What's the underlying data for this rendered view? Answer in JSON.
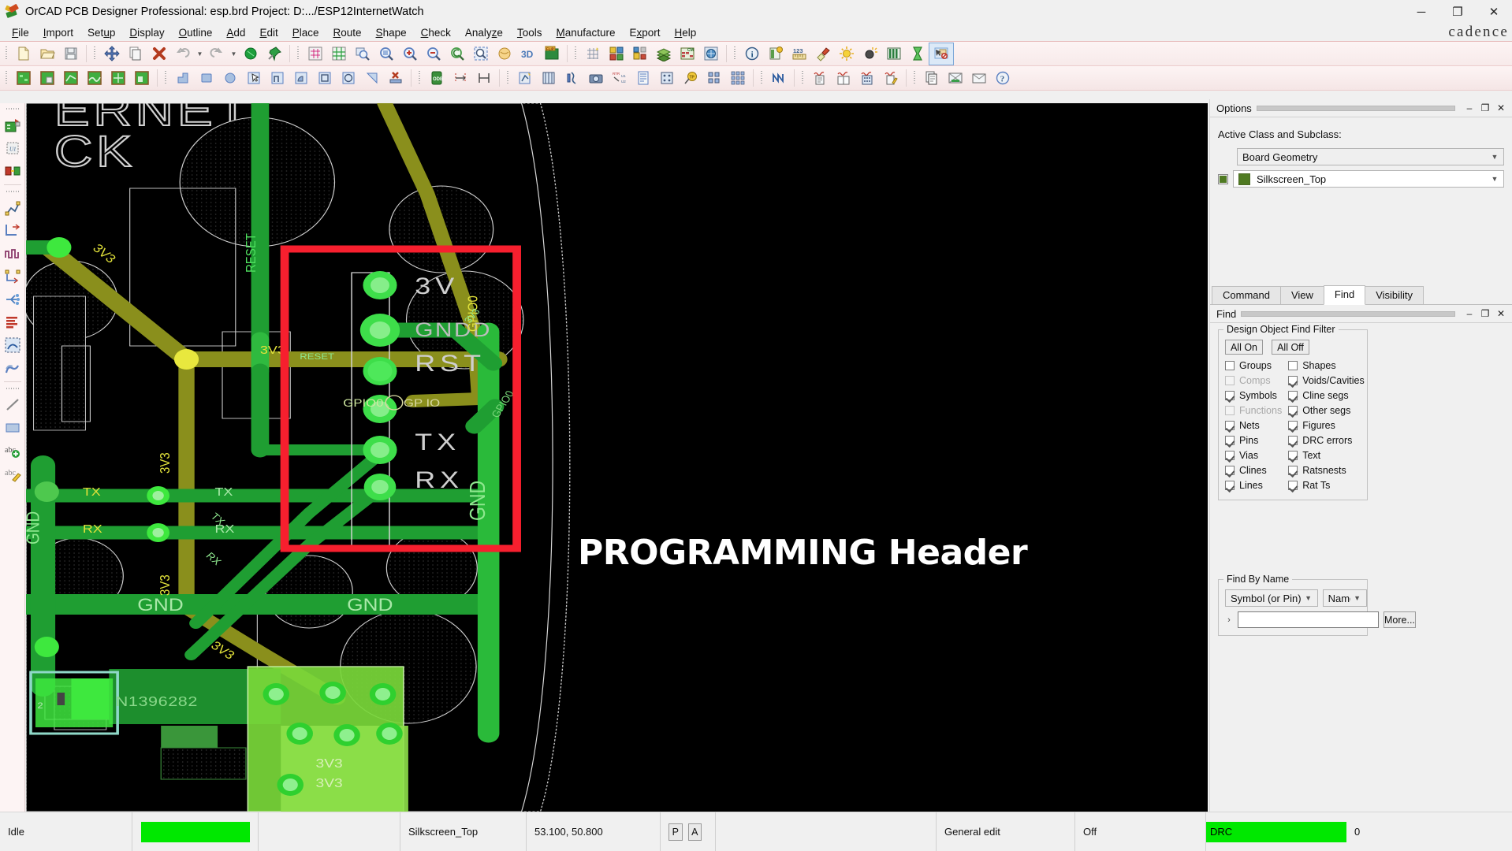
{
  "window": {
    "title": "OrCAD PCB Designer Professional: esp.brd  Project: D:.../ESP12InternetWatch",
    "minimize": "─",
    "maximize": "❐",
    "close": "✕",
    "app_icon": "orcad-logo-icon"
  },
  "menubar": {
    "items": [
      {
        "label": "File",
        "mnemonic": "F"
      },
      {
        "label": "Import",
        "mnemonic": "I"
      },
      {
        "label": "Setup",
        "mnemonic": "u"
      },
      {
        "label": "Display",
        "mnemonic": "D"
      },
      {
        "label": "Outline",
        "mnemonic": "O"
      },
      {
        "label": "Add",
        "mnemonic": "A"
      },
      {
        "label": "Edit",
        "mnemonic": "E"
      },
      {
        "label": "Place",
        "mnemonic": "P"
      },
      {
        "label": "Route",
        "mnemonic": "R"
      },
      {
        "label": "Shape",
        "mnemonic": "S"
      },
      {
        "label": "Check",
        "mnemonic": "C"
      },
      {
        "label": "Analyze",
        "mnemonic": "z"
      },
      {
        "label": "Tools",
        "mnemonic": "T"
      },
      {
        "label": "Manufacture",
        "mnemonic": "M"
      },
      {
        "label": "Export",
        "mnemonic": "x"
      },
      {
        "label": "Help",
        "mnemonic": "H"
      }
    ],
    "brand": "cadence"
  },
  "toolbar_row1": [
    "new-file-icon",
    "open-folder-icon",
    "save-icon",
    "move-icon",
    "copy-icon",
    "delete-icon",
    "undo-icon",
    "undo-dropdown-icon",
    "redo-icon",
    "redo-dropdown-icon",
    "net-highlight-icon",
    "pin-icon",
    "redraw-icon",
    "color-views-icon",
    "zoom-by-points-icon",
    "zoom-fit-icon",
    "zoom-in-icon",
    "zoom-out-icon",
    "zoom-previous-icon",
    "zoom-selection-icon",
    "zoom-world-icon",
    "3d-view-icon",
    "flip-design-icon",
    "grid-toggle-icon",
    "color-visibility-icon",
    "assign-color-icon",
    "layers-icon",
    "constraint-manager-icon",
    "global-visibility-icon",
    "property-info-icon",
    "report-icon",
    "measure-icon",
    "highlight-paint-icon",
    "display-brightness-icon",
    "dimming-icon",
    "layer-bars-icon",
    "hourglass-icon",
    "select-nothing-icon"
  ],
  "toolbar_row2": [
    "shape-add-rect-icon",
    "shape-add-circle-icon",
    "shape-edit-boundary-icon",
    "shape-merge-icon",
    "shape-delete-island-icon",
    "shape-change-icon",
    "place-manual-icon",
    "place-rect-icon",
    "place-circle-icon",
    "select-cursor-icon",
    "place-polygon-icon",
    "place-arc-icon",
    "place-square-icon",
    "place-ellipse-icon",
    "place-line-icon",
    "unplace-icon",
    "odb-export-icon",
    "route-spacing-icon",
    "route-spacing2-icon",
    "drc-check-icon",
    "cross-section-icon",
    "probe-icon",
    "camera-icon",
    "swap-pins-icon",
    "bom-report-icon",
    "padstack-icon",
    "testpoint-icon",
    "array-icon",
    "fanout-icon",
    "net-schedule-icon",
    "waveform-report-icon",
    "library-book-icon",
    "signal-model-icon",
    "signal-edit-icon",
    "docs-icon",
    "cross-probe-icon",
    "letter-icon",
    "help-question-icon"
  ],
  "left_toolbar": [
    "place-component-icon",
    "symbol-u1-icon",
    "swap-component-icon",
    "add-connect-icon",
    "slide-icon",
    "delay-tune-icon",
    "custom-smooth-icon",
    "fanout-by-pin-icon",
    "route-spreadsheet-icon",
    "route-area-icon",
    "gloss-icon",
    "line-icon",
    "rectangle-icon",
    "add-text-icon",
    "edit-text-icon"
  ],
  "canvas": {
    "annotation_title": "PROGRAMMING Header",
    "highlight_rect_color": "#f71f2e",
    "silkscreen_text": [
      "ERNET",
      "CK"
    ],
    "header_pins": [
      {
        "label": "3V",
        "net": "3V3"
      },
      {
        "label": "GND",
        "net": "GND"
      },
      {
        "label": "RST",
        "net": "RESET"
      },
      {
        "label": "GPIO0",
        "net": "GPIO0"
      },
      {
        "label": "TX",
        "net": "TX"
      },
      {
        "label": "RX",
        "net": "RX"
      }
    ],
    "net_labels": [
      "3V3",
      "RESET",
      "GND",
      "TX",
      "RX",
      "GPIO0",
      "GP IO",
      "3V3"
    ],
    "component_ref": "N1396282",
    "secondary_labels": [
      "GNDD",
      "GND",
      "3V3"
    ]
  },
  "options_panel": {
    "dock_title": "Options",
    "active_class_label": "Active Class and Subclass:",
    "class_value": "Board Geometry",
    "subclass_value": "Silkscreen_Top",
    "subclass_color": "#4f7a22",
    "minimize": "–",
    "restore": "❐",
    "close": "✕"
  },
  "panel_tabs": [
    {
      "label": "Command",
      "selected": false
    },
    {
      "label": "View",
      "selected": false
    },
    {
      "label": "Find",
      "selected": true
    },
    {
      "label": "Visibility",
      "selected": false
    }
  ],
  "find_panel": {
    "dock_title": "Find",
    "minimize": "–",
    "restore": "❐",
    "close": "✕",
    "filter_legend": "Design Object Find Filter",
    "all_on": "All On",
    "all_off": "All Off",
    "checkboxes": [
      {
        "label": "Groups",
        "checked": false,
        "enabled": true
      },
      {
        "label": "Shapes",
        "checked": false,
        "enabled": true
      },
      {
        "label": "Comps",
        "checked": false,
        "enabled": false
      },
      {
        "label": "Voids/Cavities",
        "checked": true,
        "enabled": true
      },
      {
        "label": "Symbols",
        "checked": true,
        "enabled": true
      },
      {
        "label": "Cline segs",
        "checked": true,
        "enabled": true
      },
      {
        "label": "Functions",
        "checked": false,
        "enabled": false
      },
      {
        "label": "Other segs",
        "checked": true,
        "enabled": true
      },
      {
        "label": "Nets",
        "checked": true,
        "enabled": true
      },
      {
        "label": "Figures",
        "checked": true,
        "enabled": true
      },
      {
        "label": "Pins",
        "checked": true,
        "enabled": true
      },
      {
        "label": "DRC errors",
        "checked": true,
        "enabled": true
      },
      {
        "label": "Vias",
        "checked": true,
        "enabled": true
      },
      {
        "label": "Text",
        "checked": true,
        "enabled": true
      },
      {
        "label": "Clines",
        "checked": true,
        "enabled": true
      },
      {
        "label": "Ratsnests",
        "checked": true,
        "enabled": true
      },
      {
        "label": "Lines",
        "checked": true,
        "enabled": true
      },
      {
        "label": "Rat Ts",
        "checked": true,
        "enabled": true
      }
    ],
    "find_by_name_legend": "Find By Name",
    "object_type": "Symbol (or Pin)",
    "match_mode": "Name",
    "name_value": "",
    "more_button": "More...",
    "expand_chevron": "›"
  },
  "statusbar": {
    "idle": "Idle",
    "progress_color": "#00e800",
    "active_subclass": "Silkscreen_Top",
    "coordinates": "53.100, 50.800",
    "key_p": "P",
    "key_a": "A",
    "mode": "General edit",
    "state": "Off",
    "drc_label": "DRC",
    "drc_count": "0",
    "drc_color": "#00e800"
  }
}
